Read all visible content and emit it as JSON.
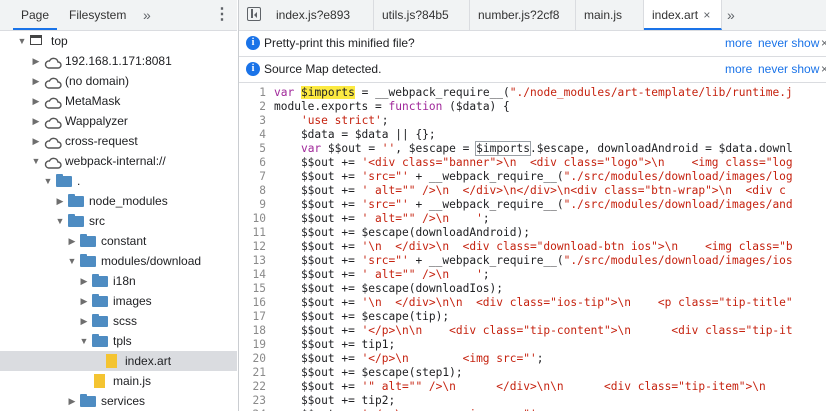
{
  "navigator": {
    "tabs": [
      "Page",
      "Filesystem"
    ],
    "more": "»",
    "menu": "⋮",
    "tree": [
      {
        "label": "top",
        "icon": "frame-icon",
        "depth": 0,
        "expanded": true
      },
      {
        "label": "192.168.1.171:8081",
        "icon": "cloud-icon",
        "depth": 1,
        "expanded": false
      },
      {
        "label": "(no domain)",
        "icon": "cloud-icon",
        "depth": 1,
        "expanded": false
      },
      {
        "label": "MetaMask",
        "icon": "cloud-icon",
        "depth": 1,
        "expanded": false
      },
      {
        "label": "Wappalyzer",
        "icon": "cloud-icon",
        "depth": 1,
        "expanded": false
      },
      {
        "label": "cross-request",
        "icon": "cloud-icon",
        "depth": 1,
        "expanded": false
      },
      {
        "label": "webpack-internal://",
        "icon": "cloud-icon",
        "depth": 1,
        "expanded": true
      },
      {
        "label": ".",
        "icon": "folder-icon",
        "depth": 2,
        "expanded": true
      },
      {
        "label": "node_modules",
        "icon": "folder-icon",
        "depth": 3,
        "expanded": false
      },
      {
        "label": "src",
        "icon": "folder-icon",
        "depth": 3,
        "expanded": true
      },
      {
        "label": "constant",
        "icon": "folder-icon",
        "depth": 4,
        "expanded": false
      },
      {
        "label": "modules/download",
        "icon": "folder-icon",
        "depth": 4,
        "expanded": true
      },
      {
        "label": "i18n",
        "icon": "folder-icon",
        "depth": 5,
        "expanded": false
      },
      {
        "label": "images",
        "icon": "folder-icon",
        "depth": 5,
        "expanded": false
      },
      {
        "label": "scss",
        "icon": "folder-icon",
        "depth": 5,
        "expanded": false
      },
      {
        "label": "tpls",
        "icon": "folder-icon",
        "depth": 5,
        "expanded": true
      },
      {
        "label": "index.art",
        "icon": "file-icon",
        "depth": 6,
        "expanded": null,
        "selected": true
      },
      {
        "label": "main.js",
        "icon": "file-icon",
        "depth": 5,
        "expanded": null
      },
      {
        "label": "services",
        "icon": "folder-icon",
        "depth": 4,
        "expanded": false
      }
    ]
  },
  "editor": {
    "tabs": [
      {
        "label": "index.js?e893",
        "active": false
      },
      {
        "label": "utils.js?84b5",
        "active": false
      },
      {
        "label": "number.js?2cf8",
        "active": false
      },
      {
        "label": "main.js",
        "active": false
      },
      {
        "label": "index.art",
        "active": true,
        "close": "×"
      }
    ],
    "tabs_more": "»",
    "infobars": [
      {
        "text": "Pretty-print this minified file?",
        "more": "more",
        "never": "never show",
        "close": "×"
      },
      {
        "text": "Source Map detected.",
        "more": "more",
        "never": "never show",
        "close": "×"
      }
    ],
    "code": [
      "var $imports = __webpack_require__(\"./node_modules/art-template/lib/runtime.j",
      "module.exports = function ($data) {",
      "    'use strict';",
      "    $data = $data || {};",
      "    var $$out = '', $escape = $imports.$escape, downloadAndroid = $data.downl",
      "    $$out += '<div class=\"banner\">\\n  <div class=\"logo\">\\n    <img class=\"log",
      "    $$out += 'src=\"' + __webpack_require__(\"./src/modules/download/images/log",
      "    $$out += ' alt=\"\" />\\n  </div>\\n</div>\\n<div class=\"btn-wrap\">\\n  <div c",
      "    $$out += 'src=\"' + __webpack_require__(\"./src/modules/download/images/and",
      "    $$out += ' alt=\"\" />\\n    ';",
      "    $$out += $escape(downloadAndroid);",
      "    $$out += '\\n  </div>\\n  <div class=\"download-btn ios\">\\n    <img class=\"b",
      "    $$out += 'src=\"' + __webpack_require__(\"./src/modules/download/images/ios",
      "    $$out += ' alt=\"\" />\\n    ';",
      "    $$out += $escape(downloadIos);",
      "    $$out += '\\n  </div>\\n\\n  <div class=\"ios-tip\">\\n    <p class=\"tip-title\"",
      "    $$out += $escape(tip);",
      "    $$out += '</p>\\n\\n    <div class=\"tip-content\">\\n      <div class=\"tip-it",
      "    $$out += tip1;",
      "    $$out += '</p>\\n        <img src=\"';",
      "    $$out += $escape(step1);",
      "    $$out += '\" alt=\"\" />\\n      </div>\\n\\n      <div class=\"tip-item\">\\n",
      "    $$out += tip2;",
      "    $$out += '</p>\\n        <img src=\"';"
    ],
    "colors": {
      "accent": "#1a73e8",
      "keyword": "#a0289a",
      "string": "#c5220f",
      "highlight": "#fcea41"
    }
  }
}
